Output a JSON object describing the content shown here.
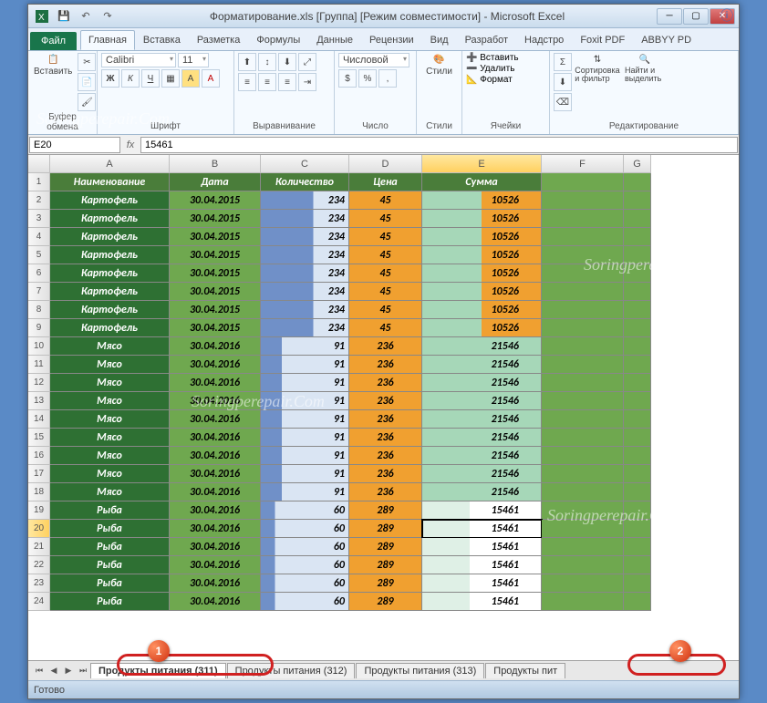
{
  "title": "Форматирование.xls  [Группа]  [Режим совместимости] - Microsoft Excel",
  "ribbon": {
    "file": "Файл",
    "tabs": [
      "Главная",
      "Вставка",
      "Разметка",
      "Формулы",
      "Данные",
      "Рецензии",
      "Вид",
      "Разработ",
      "Надстро",
      "Foxit PDF",
      "ABBYY PD"
    ],
    "active": 0,
    "groups": {
      "clipboard": {
        "label": "Буфер обмена",
        "paste": "Вставить"
      },
      "font": {
        "label": "Шрифт",
        "name": "Calibri",
        "size": "11",
        "bold": "Ж",
        "italic": "К",
        "underline": "Ч"
      },
      "align": {
        "label": "Выравнивание"
      },
      "number": {
        "label": "Число",
        "fmt": "Числовой"
      },
      "styles": {
        "label": "Стили",
        "btn": "Стили"
      },
      "cells": {
        "label": "Ячейки",
        "insert": "Вставить",
        "delete": "Удалить",
        "format": "Формат"
      },
      "editing": {
        "label": "Редактирование",
        "sort": "Сортировка и фильтр",
        "find": "Найти и выделить"
      }
    }
  },
  "namebox": "E20",
  "formula": "15461",
  "columns": [
    "",
    "A",
    "B",
    "C",
    "D",
    "E",
    "F",
    "G"
  ],
  "selected_col": 5,
  "selected_row": 20,
  "headers": [
    "Наименование",
    "Дата",
    "Количество",
    "Цена",
    "Сумма"
  ],
  "rows": [
    {
      "n": 2,
      "a": "Картофель",
      "b": "30.04.2015",
      "c": "234",
      "cc": "c",
      "d": "45",
      "e": "10526",
      "ec": "e1"
    },
    {
      "n": 3,
      "a": "Картофель",
      "b": "30.04.2015",
      "c": "234",
      "cc": "c",
      "d": "45",
      "e": "10526",
      "ec": "e1"
    },
    {
      "n": 4,
      "a": "Картофель",
      "b": "30.04.2015",
      "c": "234",
      "cc": "c",
      "d": "45",
      "e": "10526",
      "ec": "e1"
    },
    {
      "n": 5,
      "a": "Картофель",
      "b": "30.04.2015",
      "c": "234",
      "cc": "c",
      "d": "45",
      "e": "10526",
      "ec": "e1"
    },
    {
      "n": 6,
      "a": "Картофель",
      "b": "30.04.2015",
      "c": "234",
      "cc": "c",
      "d": "45",
      "e": "10526",
      "ec": "e1"
    },
    {
      "n": 7,
      "a": "Картофель",
      "b": "30.04.2015",
      "c": "234",
      "cc": "c",
      "d": "45",
      "e": "10526",
      "ec": "e1"
    },
    {
      "n": 8,
      "a": "Картофель",
      "b": "30.04.2015",
      "c": "234",
      "cc": "c",
      "d": "45",
      "e": "10526",
      "ec": "e1"
    },
    {
      "n": 9,
      "a": "Картофель",
      "b": "30.04.2015",
      "c": "234",
      "cc": "c",
      "d": "45",
      "e": "10526",
      "ec": "e1"
    },
    {
      "n": 10,
      "a": "Мясо",
      "b": "30.04.2016",
      "c": "91",
      "cc": "c2",
      "d": "236",
      "e": "21546",
      "ec": "e2"
    },
    {
      "n": 11,
      "a": "Мясо",
      "b": "30.04.2016",
      "c": "91",
      "cc": "c2",
      "d": "236",
      "e": "21546",
      "ec": "e2"
    },
    {
      "n": 12,
      "a": "Мясо",
      "b": "30.04.2016",
      "c": "91",
      "cc": "c2",
      "d": "236",
      "e": "21546",
      "ec": "e2"
    },
    {
      "n": 13,
      "a": "Мясо",
      "b": "30.04.2016",
      "c": "91",
      "cc": "c2",
      "d": "236",
      "e": "21546",
      "ec": "e2"
    },
    {
      "n": 14,
      "a": "Мясо",
      "b": "30.04.2016",
      "c": "91",
      "cc": "c2",
      "d": "236",
      "e": "21546",
      "ec": "e2"
    },
    {
      "n": 15,
      "a": "Мясо",
      "b": "30.04.2016",
      "c": "91",
      "cc": "c2",
      "d": "236",
      "e": "21546",
      "ec": "e2"
    },
    {
      "n": 16,
      "a": "Мясо",
      "b": "30.04.2016",
      "c": "91",
      "cc": "c2",
      "d": "236",
      "e": "21546",
      "ec": "e2"
    },
    {
      "n": 17,
      "a": "Мясо",
      "b": "30.04.2016",
      "c": "91",
      "cc": "c2",
      "d": "236",
      "e": "21546",
      "ec": "e2"
    },
    {
      "n": 18,
      "a": "Мясо",
      "b": "30.04.2016",
      "c": "91",
      "cc": "c2",
      "d": "236",
      "e": "21546",
      "ec": "e2"
    },
    {
      "n": 19,
      "a": "Рыба",
      "b": "30.04.2016",
      "c": "60",
      "cc": "c3",
      "d": "289",
      "e": "15461",
      "ec": "e3"
    },
    {
      "n": 20,
      "a": "Рыба",
      "b": "30.04.2016",
      "c": "60",
      "cc": "c3",
      "d": "289",
      "e": "15461",
      "ec": "e3",
      "active": true
    },
    {
      "n": 21,
      "a": "Рыба",
      "b": "30.04.2016",
      "c": "60",
      "cc": "c3",
      "d": "289",
      "e": "15461",
      "ec": "e3"
    },
    {
      "n": 22,
      "a": "Рыба",
      "b": "30.04.2016",
      "c": "60",
      "cc": "c3",
      "d": "289",
      "e": "15461",
      "ec": "e3"
    },
    {
      "n": 23,
      "a": "Рыба",
      "b": "30.04.2016",
      "c": "60",
      "cc": "c3",
      "d": "289",
      "e": "15461",
      "ec": "e3"
    },
    {
      "n": 24,
      "a": "Рыба",
      "b": "30.04.2016",
      "c": "60",
      "cc": "c3",
      "d": "289",
      "e": "15461",
      "ec": "e3"
    }
  ],
  "sheets": [
    "Продукты питания (311)",
    "Продукты питания (312)",
    "Продукты питания (313)",
    "Продукты пит"
  ],
  "active_sheet": 0,
  "status": "Готово",
  "badges": {
    "1": "1",
    "2": "2"
  },
  "watermark": "Soringperepair.Com"
}
